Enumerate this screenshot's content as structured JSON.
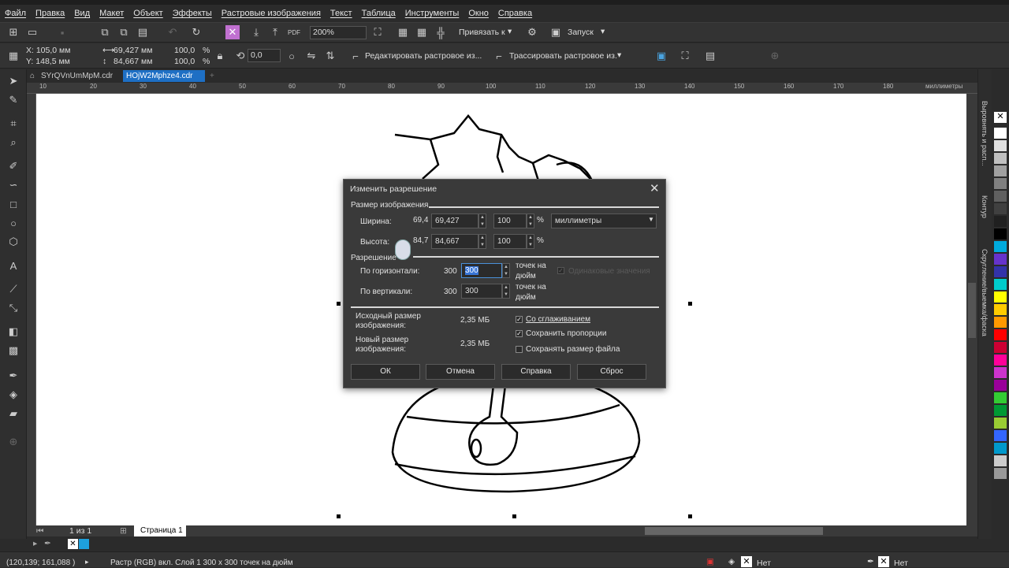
{
  "menu": [
    "Файл",
    "Правка",
    "Вид",
    "Макет",
    "Объект",
    "Эффекты",
    "Растровые изображения",
    "Текст",
    "Таблица",
    "Инструменты",
    "Окно",
    "Справка"
  ],
  "stdbar": {
    "zoom": "200%",
    "snap_label": "Привязать к",
    "launch_label": "Запуск"
  },
  "propbar": {
    "x": "X: 105,0 мм",
    "y": "Y: 148,5 мм",
    "w": "69,427 мм",
    "h": "84,667 мм",
    "sx": "100,0",
    "sy": "100,0",
    "pct": "%",
    "angle": "0,0",
    "edit_bitmap": "Редактировать растровое из...",
    "trace_bitmap": "Трассировать растровое из."
  },
  "tabs": {
    "doc1": "SYrQVnUmMpM.cdr",
    "doc2": "HOjW2Mphze4.cdr"
  },
  "ruler": {
    "units": "миллиметры",
    "ticks": [
      "10",
      "20",
      "30",
      "40",
      "50",
      "60",
      "70",
      "80",
      "90",
      "100",
      "110",
      "120",
      "130",
      "140",
      "150",
      "160",
      "170",
      "180"
    ]
  },
  "page_nav": {
    "counter": "1 из 1",
    "page_tab": "Страница 1"
  },
  "right_dock": {
    "align": "Выровнять и расп...",
    "contour": "Контур",
    "round": "Скругление/выемка/фаска"
  },
  "status": {
    "coords": "(120,139; 161,088 )",
    "info": "Растр (RGB) вкл. Слой 1 300 x 300 точек на дюйм",
    "fill": "Нет",
    "outline": "Нет"
  },
  "dialog": {
    "title": "Изменить разрешение",
    "section_size": "Размер изображения",
    "width_label": "Ширина:",
    "width_orig": "69,4",
    "width_value": "69,427",
    "width_pct": "100",
    "height_label": "Высота:",
    "height_orig": "84,7",
    "height_value": "84,667",
    "height_pct": "100",
    "pct_sign": "%",
    "units": "миллиметры",
    "section_res": "Разрешение",
    "horiz_label": "По горизонтали:",
    "horiz_orig": "300",
    "horiz_value": "300",
    "vert_label": "По вертикали:",
    "vert_orig": "300",
    "vert_value": "300",
    "dpi_line1": "точек на",
    "dpi_line2": "дюйм",
    "same_value": "Одинаковые значения",
    "orig_size_l1": "Исходный размер",
    "orig_size_l2": "изображения:",
    "orig_size": "2,35 МБ",
    "new_size_l1": "Новый размер",
    "new_size_l2": "изображения:",
    "new_size": "2,35 МБ",
    "antialias": "Со сглаживанием",
    "keep_ratio": "Сохранить пропорции",
    "keep_filesize": "Сохранять размер файла",
    "ok": "ОК",
    "cancel": "Отмена",
    "help": "Справка",
    "reset": "Сброс"
  },
  "palette_colors": [
    "#ffffff",
    "#e0e0e0",
    "#c0c0c0",
    "#a0a0a0",
    "#808080",
    "#606060",
    "#404040",
    "#202020",
    "#000000",
    "#00aadd",
    "#6633cc",
    "#3333aa",
    "#00cccc",
    "#ffff00",
    "#ffcc00",
    "#ff9900",
    "#ff0000",
    "#cc0033",
    "#ff0099",
    "#cc33cc",
    "#990099",
    "#33cc33",
    "#009933",
    "#99cc33",
    "#3366ff",
    "#0099cc",
    "#cccccc",
    "#999999"
  ]
}
